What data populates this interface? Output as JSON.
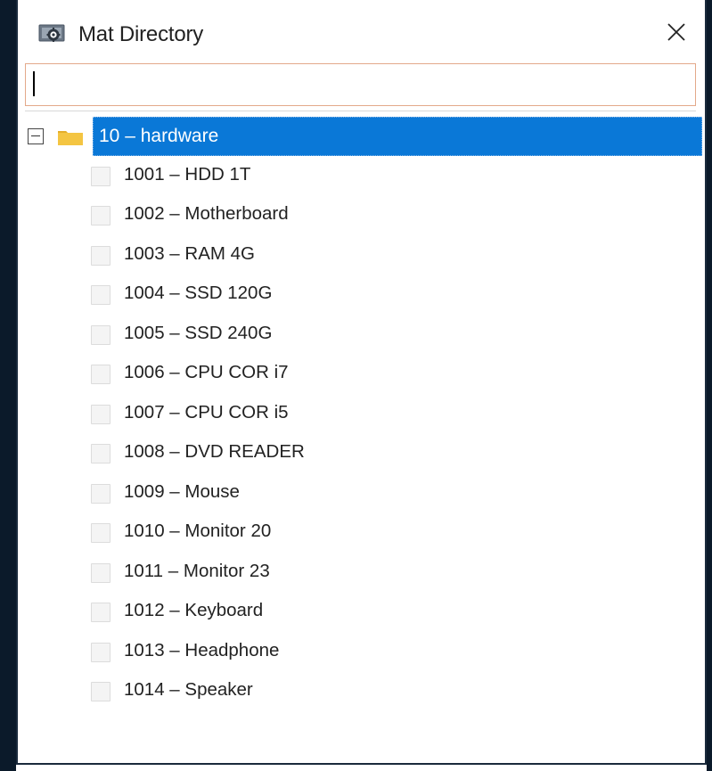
{
  "window": {
    "title": "Mat Directory",
    "title_icon": "gear-window-icon",
    "close_icon": "close-icon"
  },
  "search": {
    "value": "",
    "placeholder": ""
  },
  "tree": {
    "root": {
      "label": "10 – hardware",
      "expanded": true,
      "selected": true,
      "icon": "folder-icon"
    },
    "children": [
      {
        "label": "1001 – HDD 1T",
        "checked": false
      },
      {
        "label": "1002 – Motherboard",
        "checked": false
      },
      {
        "label": "1003 – RAM 4G",
        "checked": false
      },
      {
        "label": "1004 – SSD 120G",
        "checked": false
      },
      {
        "label": "1005 – SSD 240G",
        "checked": false
      },
      {
        "label": "1006 – CPU COR i7",
        "checked": false
      },
      {
        "label": "1007 – CPU COR i5",
        "checked": false
      },
      {
        "label": "1008 – DVD READER",
        "checked": false
      },
      {
        "label": "1009 – Mouse",
        "checked": false
      },
      {
        "label": "1010 – Monitor 20",
        "checked": false
      },
      {
        "label": "1011 – Monitor 23",
        "checked": false
      },
      {
        "label": "1012 – Keyboard",
        "checked": false
      },
      {
        "label": "1013 – Headphone",
        "checked": false
      },
      {
        "label": "1014 – Speaker",
        "checked": false
      }
    ]
  },
  "colors": {
    "selection": "#0a78d7",
    "search_border": "#e3a98a",
    "folder": "#f4c542"
  }
}
